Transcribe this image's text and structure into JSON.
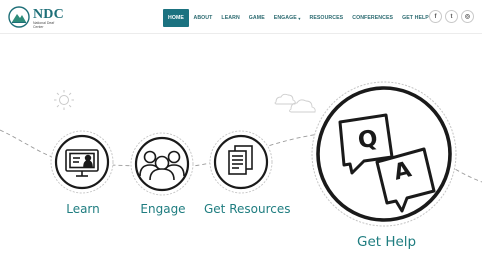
{
  "brand": {
    "name": "NDC",
    "tagline": "National Deaf Center"
  },
  "nav": {
    "items": [
      {
        "label": "HOME",
        "active": true
      },
      {
        "label": "ABOUT",
        "active": false
      },
      {
        "label": "LEARN",
        "active": false
      },
      {
        "label": "GAME",
        "active": false
      },
      {
        "label": "ENGAGE",
        "active": false,
        "dropdown": true
      },
      {
        "label": "RESOURCES",
        "active": false
      },
      {
        "label": "CONFERENCES",
        "active": false
      },
      {
        "label": "GET HELP",
        "active": false
      }
    ],
    "dropdown_caret": "▾"
  },
  "social": [
    {
      "icon": "facebook-icon",
      "glyph": "f"
    },
    {
      "icon": "twitter-icon",
      "glyph": "t"
    },
    {
      "icon": "instagram-icon",
      "glyph": "◎"
    }
  ],
  "hero": {
    "learn_label": "Learn",
    "engage_label": "Engage",
    "resources_label": "Get Resources",
    "help_label": "Get Help",
    "qa_q": "Q",
    "qa_a": "A"
  },
  "colors": {
    "accent": "#1b7280",
    "label": "#1f7d80",
    "outline": "#1a1a1a"
  }
}
